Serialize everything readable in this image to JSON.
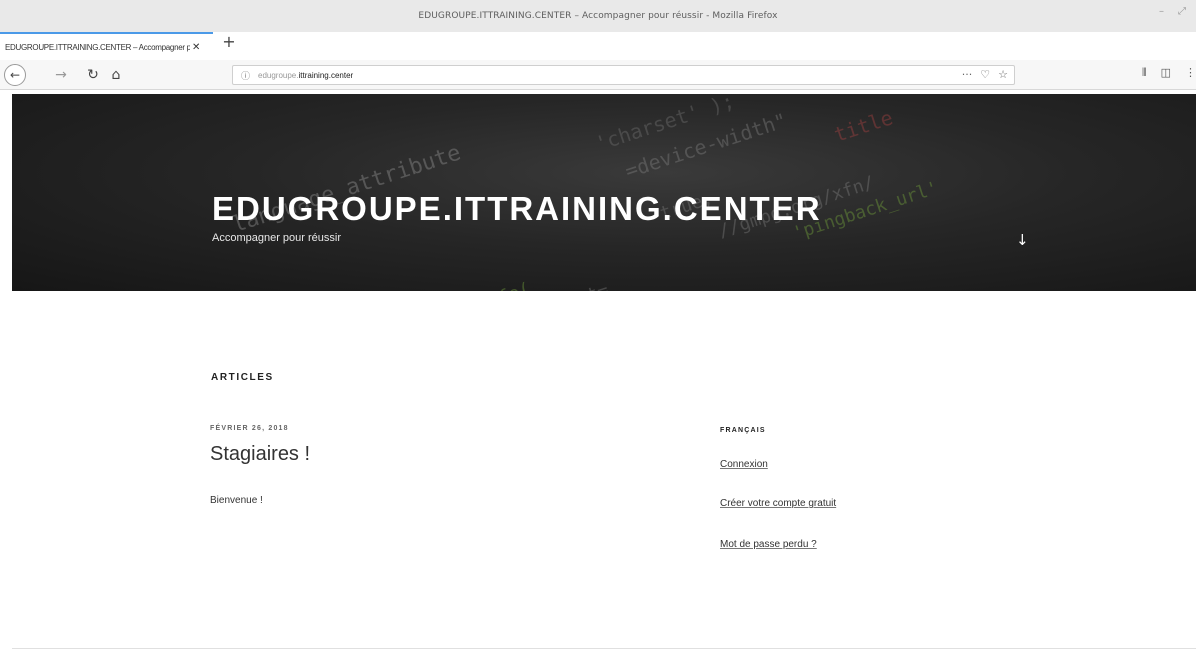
{
  "window": {
    "title": "EDUGROUPE.ITTRAINING.CENTER – Accompagner pour réussir - Mozilla Firefox",
    "controls": [
      "–",
      "⤢"
    ]
  },
  "tab": {
    "title": "EDUGROUPE.ITTRAINING.CENTER – Accompagner pour réussir",
    "close_label": "✕",
    "new_tab_label": "+"
  },
  "navbar": {
    "url_prefix": "edugroupe.",
    "url_domain": "ittraining.center",
    "icons": [
      "back-icon",
      "forward-icon",
      "reload-icon",
      "home-icon",
      "info-icon",
      "more-icon",
      "pocket-icon",
      "bookmark-star-icon",
      "library-icon",
      "sidebar-icon",
      "menu-icon"
    ]
  },
  "header": {
    "site_title": "EDUGROUPE.ITTRAINING.CENTER",
    "tagline": "Accompagner pour réussir",
    "scroll_icon": "↓"
  },
  "main": {
    "section_heading": "ARTICLES",
    "post": {
      "date": "FÉVRIER 26, 2018",
      "title": "Stagiaires !",
      "excerpt": "Bienvenue !"
    }
  },
  "sidebar": {
    "widget_title": "FRANÇAIS",
    "links": [
      "Connexion",
      "Créer votre compte gratuit",
      "Mot de passe perdu ?"
    ]
  }
}
